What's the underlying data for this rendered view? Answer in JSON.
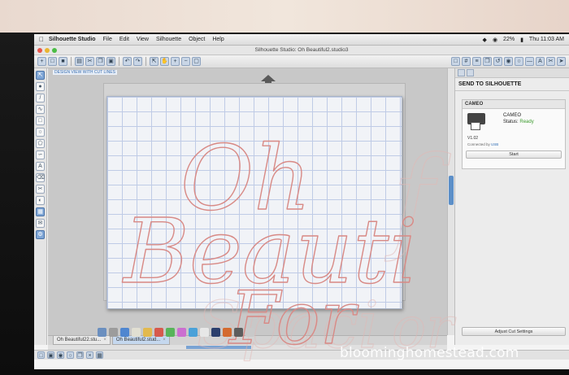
{
  "menubar": {
    "app_name": "Silhouette Studio",
    "items": [
      "File",
      "Edit",
      "View",
      "Silhouette",
      "Object",
      "Help"
    ],
    "battery": "22%",
    "clock": "Thu 11:03 AM"
  },
  "window": {
    "title": "Silhouette Studio: Oh Beautiful2.studio3"
  },
  "canvas": {
    "view_label": "DESIGN VIEW WITH CUT LINES",
    "design_text": [
      "Oh",
      "Beauti",
      "For"
    ],
    "ghost_text": [
      "f",
      "Spaci",
      "or"
    ],
    "cut_line_color": "#d88a86",
    "grid_color": "#bfcbe6"
  },
  "panel": {
    "title": "SEND TO SILHOUETTE",
    "device_header": "CAMEO",
    "device_name": "CAMEO",
    "status_label": "Status:",
    "status_value": "Ready",
    "version": "V1.02",
    "connected_label": "Connected by",
    "connected_value": "USB",
    "start_label": "Start",
    "adjust_label": "Adjust Cut Settings"
  },
  "doc_tabs": [
    {
      "label": "Oh Beautiful22.stu..."
    },
    {
      "label": "Oh Beautiful2.stud..."
    }
  ],
  "watermark": "bloominghomestead.com",
  "icons": {
    "toolbar": [
      "new-document-icon",
      "open-icon",
      "save-icon",
      "print-icon",
      "cut-icon",
      "copy-icon",
      "paste-icon",
      "undo-icon",
      "redo-icon",
      "select-icon",
      "pan-icon",
      "zoom-in-icon",
      "zoom-out-icon",
      "zoom-fit-icon"
    ],
    "rail": [
      "pointer-icon",
      "edit-points-icon",
      "line-icon",
      "curve-icon",
      "rectangle-icon",
      "ellipse-icon",
      "polygon-icon",
      "freehand-icon",
      "text-icon",
      "eraser-icon",
      "knife-icon",
      "fill-icon",
      "library-icon",
      "store-icon",
      "cut-icon"
    ]
  }
}
